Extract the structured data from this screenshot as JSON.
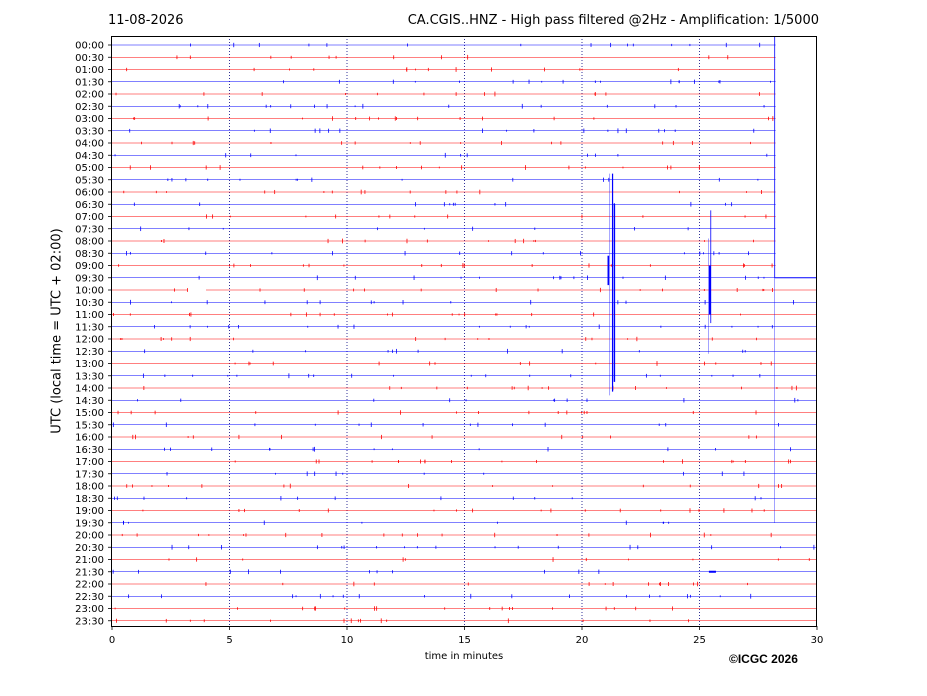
{
  "header": {
    "date": "11-08-2026",
    "title": "CA.CGIS..HNZ - High pass filtered @2Hz - Amplification: 1/5000"
  },
  "footer": {
    "copyright": "©ICGC 2026"
  },
  "colors": {
    "trace_a": "#ff0000",
    "trace_b": "#0000ff",
    "grid": "#000080"
  },
  "chart_data": {
    "type": "line",
    "title": "CA.CGIS..HNZ - High pass filtered @2Hz - Amplification: 1/5000",
    "xlabel": "time in minutes",
    "ylabel": "UTC (local time = UTC + 02:00)",
    "xlim": [
      0,
      30
    ],
    "x_ticks": [
      "0",
      "5",
      "10",
      "15",
      "20",
      "25",
      "30"
    ],
    "grid": "vertical dotted lines every 5 minutes",
    "rows": [
      "00:00",
      "00:30",
      "01:00",
      "01:30",
      "02:00",
      "02:30",
      "03:00",
      "03:30",
      "04:00",
      "04:30",
      "05:00",
      "05:30",
      "06:00",
      "06:30",
      "07:00",
      "07:30",
      "08:00",
      "08:30",
      "09:00",
      "09:30",
      "10:00",
      "10:30",
      "11:00",
      "11:30",
      "12:00",
      "12:30",
      "13:00",
      "13:30",
      "14:00",
      "14:30",
      "15:00",
      "15:30",
      "16:00",
      "16:30",
      "17:00",
      "17:30",
      "18:00",
      "18:30",
      "19:00",
      "19:30",
      "20:00",
      "20:30",
      "21:00",
      "21:30",
      "22:00",
      "22:30",
      "23:00",
      "23:30"
    ],
    "row_colors": [
      "blue",
      "red",
      "red",
      "blue",
      "red",
      "blue",
      "red",
      "blue",
      "red",
      "blue",
      "red",
      "blue",
      "red",
      "blue",
      "red",
      "blue",
      "red",
      "blue",
      "red",
      "blue",
      "red",
      "blue",
      "red",
      "blue",
      "red",
      "blue",
      "red",
      "blue",
      "red",
      "blue",
      "red",
      "blue",
      "red",
      "blue",
      "red",
      "blue",
      "red",
      "blue",
      "red",
      "blue",
      "red",
      "blue",
      "red",
      "blue",
      "red",
      "blue",
      "red",
      "red"
    ],
    "events": [
      {
        "row": "05:30",
        "minute": 21.2,
        "description": "large spike spanning to 14:00"
      },
      {
        "row": "07:00",
        "minute": 25.4,
        "description": "spike spanning to 12:30"
      },
      {
        "row": "00:00",
        "minute": 28.2,
        "description": "trace step from 00:00 down to 19:30"
      },
      {
        "row": "10:00",
        "minute": 3.6,
        "description": "data gap"
      }
    ]
  }
}
